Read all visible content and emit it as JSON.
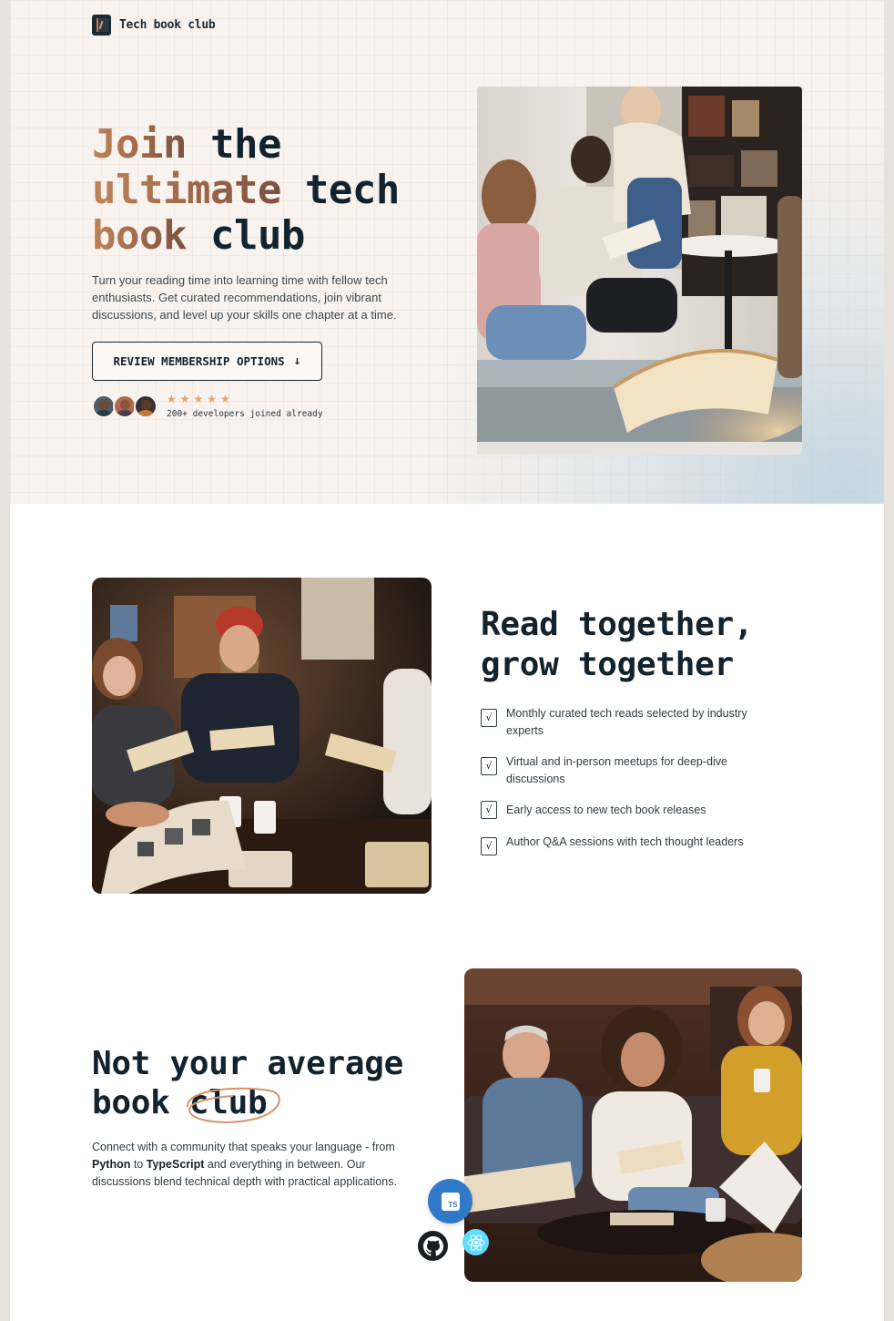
{
  "brand": {
    "name": "Tech book club",
    "logo_icon": "book-logo-icon"
  },
  "hero": {
    "title_accent_1": "Join",
    "title_1": " the",
    "title_accent_2": "ultimate",
    "title_2": " tech",
    "title_accent_3": "book",
    "title_3": " club",
    "subtitle": "Turn your reading time into learning time with fellow tech enthusiasts. Get curated recommendations, join vibrant discussions, and level up your skills one chapter at a time.",
    "cta_label": "REVIEW MEMBERSHIP OPTIONS",
    "cta_icon": "arrow-down-icon",
    "stars": "★★★★★",
    "rating_value": 5,
    "joined_text": "200+ developers joined already"
  },
  "section2": {
    "title_line1": "Read together,",
    "title_line2": "grow together",
    "check_glyph": "√",
    "features": [
      "Monthly curated tech reads selected by industry experts",
      "Virtual and in-person meetups for deep-dive discussions",
      "Early access to new tech book releases",
      "Author Q&A sessions with tech thought leaders"
    ]
  },
  "section3": {
    "title_line1": "Not your average",
    "title_line2_plain": "book ",
    "title_line2_circled": "club",
    "text_1": "Connect with a community that speaks your language - from ",
    "text_python": "Python",
    "text_2": " to ",
    "text_typescript": "TypeScript",
    "text_3": " and everything in between. Our discussions blend technical depth with practical applications.",
    "ts_badge_label": "TS"
  },
  "colors": {
    "accent": "#c08359",
    "dark": "#13232e",
    "hero_bg": "#f8f3ef",
    "star": "#e9a06c",
    "ts_blue": "#3178c6",
    "react_cyan": "#61dafb"
  }
}
